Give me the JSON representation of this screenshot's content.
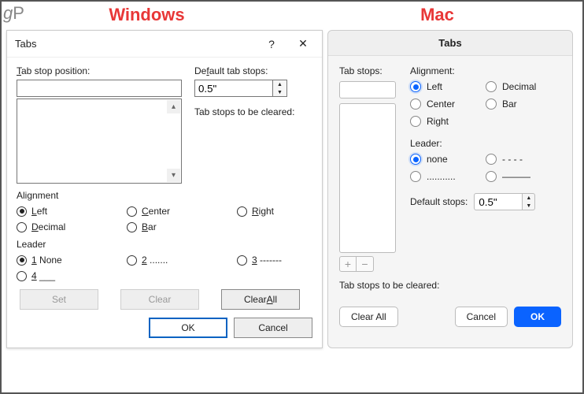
{
  "labels": {
    "windows": "Windows",
    "mac": "Mac",
    "logo": "gP"
  },
  "win": {
    "title": "Tabs",
    "help": "?",
    "close": "✕",
    "tab_stop_position_label": "Tab stop position:",
    "tab_stop_value": "",
    "default_tabs_label": "Default tab stops:",
    "default_tabs_value": "0.5\"",
    "to_be_cleared_label": "Tab stops to be cleared:",
    "alignment_label": "Alignment",
    "alignment": {
      "left": "Left",
      "center": "Center",
      "right": "Right",
      "decimal": "Decimal",
      "bar": "Bar"
    },
    "leader_label": "Leader",
    "leader": {
      "none": "1 None",
      "two": "2 .......",
      "three": "3 -------",
      "four": "4 ___"
    },
    "buttons": {
      "set": "Set",
      "clear": "Clear",
      "clear_all": "Clear All",
      "ok": "OK",
      "cancel": "Cancel"
    }
  },
  "mac": {
    "title": "Tabs",
    "tab_stops_label": "Tab stops:",
    "tab_stop_value": "",
    "alignment_label": "Alignment:",
    "alignment": {
      "left": "Left",
      "decimal": "Decimal",
      "center": "Center",
      "bar": "Bar",
      "right": "Right"
    },
    "leader_label": "Leader:",
    "leader": {
      "none": "none",
      "dashes": "- - - -",
      "dots": "...........",
      "underline": "———"
    },
    "default_stops_label": "Default stops:",
    "default_stops_value": "0.5\"",
    "to_be_cleared_label": "Tab stops to be cleared:",
    "buttons": {
      "clear_all": "Clear All",
      "cancel": "Cancel",
      "ok": "OK"
    }
  }
}
